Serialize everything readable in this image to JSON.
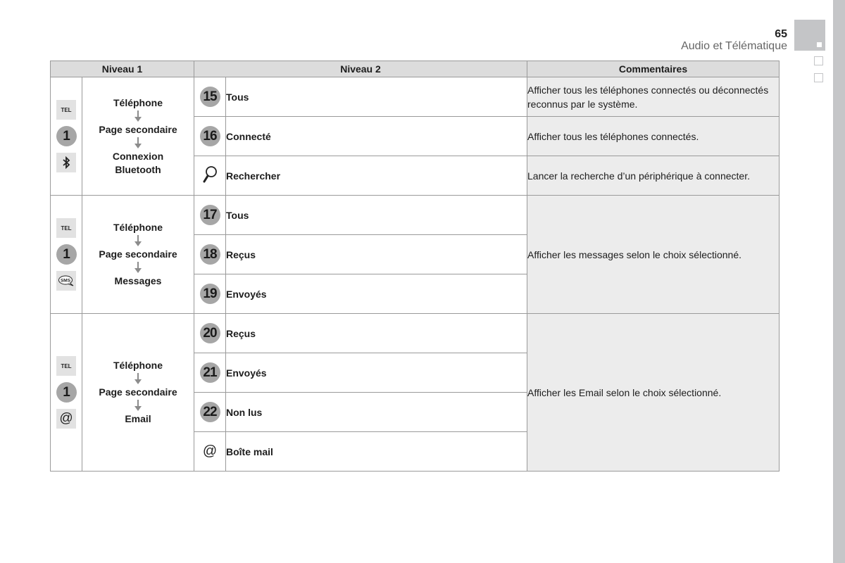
{
  "header": {
    "page_number": "65",
    "section_title": "Audio et Télématique"
  },
  "table": {
    "columns": [
      "Niveau 1",
      "Niveau 2",
      "Commentaires"
    ],
    "groups": [
      {
        "icons": [
          "TEL",
          "1",
          "bluetooth"
        ],
        "level1": [
          "Téléphone",
          "Page secondaire",
          "Connexion Bluetooth"
        ],
        "rows": [
          {
            "badge": "15",
            "label": "Tous",
            "comment": "Afficher tous les téléphones connectés ou déconnectés reconnus par le système."
          },
          {
            "badge": "16",
            "label": "Connecté",
            "comment": "Afficher tous les téléphones connectés."
          },
          {
            "badge": "search-icon",
            "label": "Rechercher",
            "comment": "Lancer la recherche d’un périphérique à connecter."
          }
        ]
      },
      {
        "icons": [
          "TEL",
          "1",
          "SMS"
        ],
        "level1": [
          "Téléphone",
          "Page secondaire",
          "Messages"
        ],
        "comment": "Afficher les messages selon le choix sélectionné.",
        "rows": [
          {
            "badge": "17",
            "label": "Tous"
          },
          {
            "badge": "18",
            "label": "Reçus"
          },
          {
            "badge": "19",
            "label": "Envoyés"
          }
        ]
      },
      {
        "icons": [
          "TEL",
          "1",
          "@"
        ],
        "level1": [
          "Téléphone",
          "Page secondaire",
          "Email"
        ],
        "comment": "Afficher les Email selon le choix sélectionné.",
        "rows": [
          {
            "badge": "20",
            "label": "Reçus"
          },
          {
            "badge": "21",
            "label": "Envoyés"
          },
          {
            "badge": "22",
            "label": "Non lus"
          },
          {
            "badge": "@",
            "label": "Boîte mail"
          }
        ]
      }
    ]
  }
}
